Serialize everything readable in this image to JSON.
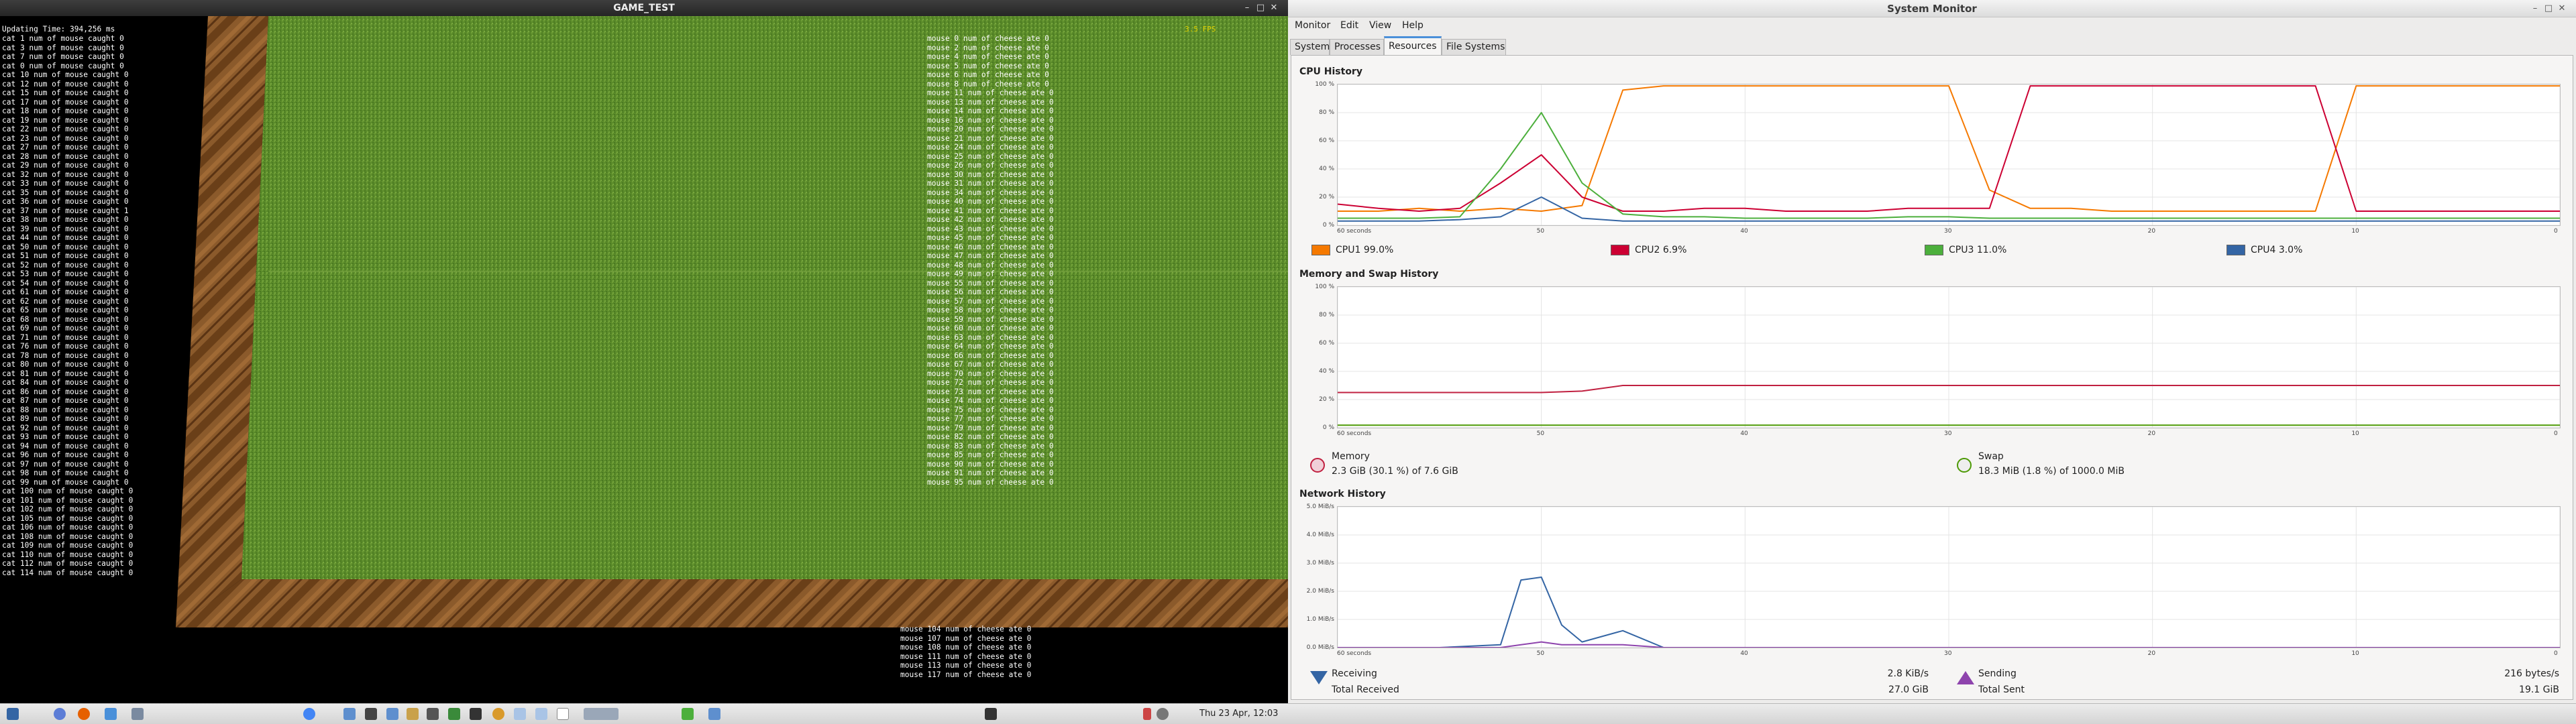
{
  "game": {
    "title": "GAME_TEST",
    "update_line": "Updating Time: 394,256 ms",
    "fps": "3.5 FPS",
    "cat_lines": [
      "cat 1 num of mouse caught 0",
      "cat 3 num of mouse caught 0",
      "cat 7 num of mouse caught 0",
      "cat 0 num of mouse caught 0",
      "cat 10 num of mouse caught 0",
      "cat 12 num of mouse caught 0",
      "cat 15 num of mouse caught 0",
      "cat 17 num of mouse caught 0",
      "cat 18 num of mouse caught 0",
      "cat 19 num of mouse caught 0",
      "cat 22 num of mouse caught 0",
      "cat 23 num of mouse caught 0",
      "cat 27 num of mouse caught 0",
      "cat 28 num of mouse caught 0",
      "cat 29 num of mouse caught 0",
      "cat 32 num of mouse caught 0",
      "cat 33 num of mouse caught 0",
      "cat 35 num of mouse caught 0",
      "cat 36 num of mouse caught 0",
      "cat 37 num of mouse caught 1",
      "cat 38 num of mouse caught 0",
      "cat 39 num of mouse caught 0",
      "cat 44 num of mouse caught 0",
      "cat 50 num of mouse caught 0",
      "cat 51 num of mouse caught 0",
      "cat 52 num of mouse caught 0",
      "cat 53 num of mouse caught 0",
      "cat 54 num of mouse caught 0",
      "cat 61 num of mouse caught 0",
      "cat 62 num of mouse caught 0",
      "cat 65 num of mouse caught 0",
      "cat 68 num of mouse caught 0",
      "cat 69 num of mouse caught 0",
      "cat 71 num of mouse caught 0",
      "cat 76 num of mouse caught 0",
      "cat 78 num of mouse caught 0",
      "cat 80 num of mouse caught 0",
      "cat 81 num of mouse caught 0",
      "cat 84 num of mouse caught 0",
      "cat 86 num of mouse caught 0",
      "cat 87 num of mouse caught 0",
      "cat 88 num of mouse caught 0",
      "cat 89 num of mouse caught 0",
      "cat 92 num of mouse caught 0",
      "cat 93 num of mouse caught 0",
      "cat 94 num of mouse caught 0",
      "cat 96 num of mouse caught 0",
      "cat 97 num of mouse caught 0",
      "cat 98 num of mouse caught 0",
      "cat 99 num of mouse caught 0",
      "cat 100 num of mouse caught 0",
      "cat 101 num of mouse caught 0",
      "cat 102 num of mouse caught 0",
      "cat 105 num of mouse caught 0",
      "cat 106 num of mouse caught 0",
      "cat 108 num of mouse caught 0",
      "cat 109 num of mouse caught 0",
      "cat 110 num of mouse caught 0",
      "cat 112 num of mouse caught 0",
      "cat 114 num of mouse caught 0"
    ],
    "mouse_lines": [
      "mouse 0 num of cheese ate 0",
      "mouse 2 num of cheese ate 0",
      "mouse 4 num of cheese ate 0",
      "mouse 5 num of cheese ate 0",
      "mouse 6 num of cheese ate 0",
      "mouse 8 num of cheese ate 0",
      "mouse 11 num of cheese ate 0",
      "mouse 13 num of cheese ate 0",
      "mouse 14 num of cheese ate 0",
      "mouse 16 num of cheese ate 0",
      "mouse 20 num of cheese ate 0",
      "mouse 21 num of cheese ate 0",
      "mouse 24 num of cheese ate 0",
      "mouse 25 num of cheese ate 0",
      "mouse 26 num of cheese ate 0",
      "mouse 30 num of cheese ate 0",
      "mouse 31 num of cheese ate 0",
      "mouse 34 num of cheese ate 0",
      "mouse 40 num of cheese ate 0",
      "mouse 41 num of cheese ate 0",
      "mouse 42 num of cheese ate 0",
      "mouse 43 num of cheese ate 0",
      "mouse 45 num of cheese ate 0",
      "mouse 46 num of cheese ate 0",
      "mouse 47 num of cheese ate 0",
      "mouse 48 num of cheese ate 0",
      "mouse 49 num of cheese ate 0",
      "mouse 55 num of cheese ate 0",
      "mouse 56 num of cheese ate 0",
      "mouse 57 num of cheese ate 0",
      "mouse 58 num of cheese ate 0",
      "mouse 59 num of cheese ate 0",
      "mouse 60 num of cheese ate 0",
      "mouse 63 num of cheese ate 0",
      "mouse 64 num of cheese ate 0",
      "mouse 66 num of cheese ate 0",
      "mouse 67 num of cheese ate 0",
      "mouse 70 num of cheese ate 0",
      "mouse 72 num of cheese ate 0",
      "mouse 73 num of cheese ate 0",
      "mouse 74 num of cheese ate 0",
      "mouse 75 num of cheese ate 0",
      "mouse 77 num of cheese ate 0",
      "mouse 79 num of cheese ate 0",
      "mouse 82 num of cheese ate 0",
      "mouse 83 num of cheese ate 0",
      "mouse 85 num of cheese ate 0",
      "mouse 90 num of cheese ate 0",
      "mouse 91 num of cheese ate 0",
      "mouse 95 num of cheese ate 0"
    ],
    "mouse_lines_bottom": [
      "mouse 104 num of cheese ate 0",
      "mouse 107 num of cheese ate 0",
      "mouse 108 num of cheese ate 0",
      "mouse 111 num of cheese ate 0",
      "mouse 113 num of cheese ate 0",
      "mouse 117 num of cheese ate 0"
    ]
  },
  "taskbar": {
    "clock": "Thu 23 Apr, 12:03"
  },
  "sysmon": {
    "title": "System Monitor",
    "menus": [
      "Monitor",
      "Edit",
      "View",
      "Help"
    ],
    "tabs": [
      "System",
      "Processes",
      "Resources",
      "File Systems"
    ],
    "active_tab": "Resources",
    "cpu_title": "CPU History",
    "mem_title": "Memory and Swap History",
    "net_title": "Network History",
    "x_ticks": [
      "60 seconds",
      "50",
      "40",
      "30",
      "20",
      "10",
      "0"
    ],
    "cpu_y_ticks": [
      "100 %",
      "80 %",
      "60 %",
      "40 %",
      "20 %",
      "0 %"
    ],
    "mem_y_ticks": [
      "100 %",
      "80 %",
      "60 %",
      "40 %",
      "20 %",
      "0 %"
    ],
    "net_y_ticks": [
      "5.0 MiB/s",
      "4.0 MiB/s",
      "3.0 MiB/s",
      "2.0 MiB/s",
      "1.0 MiB/s",
      "0.0 MiB/s"
    ],
    "cpu_legend": [
      {
        "label": "CPU1",
        "value": "99.0%",
        "color": "#f57900"
      },
      {
        "label": "CPU2",
        "value": "6.9%",
        "color": "#cc0033"
      },
      {
        "label": "CPU3",
        "value": "11.0%",
        "color": "#4caf3c"
      },
      {
        "label": "CPU4",
        "value": "3.0%",
        "color": "#3465a4"
      }
    ],
    "memory": {
      "label": "Memory",
      "value": "2.3 GiB (30.1 %) of 7.6 GiB",
      "color": "#c02040"
    },
    "swap": {
      "label": "Swap",
      "value": "18.3 MiB (1.8 %) of 1000.0 MiB",
      "color": "#4e9a06"
    },
    "network": {
      "receiving_label": "Receiving",
      "receiving_value": "2.8 KiB/s",
      "total_received_label": "Total Received",
      "total_received_value": "27.0 GiB",
      "sending_label": "Sending",
      "sending_value": "216 bytes/s",
      "total_sent_label": "Total Sent",
      "total_sent_value": "19.1 GiB"
    }
  },
  "chart_data": [
    {
      "type": "line",
      "title": "CPU History",
      "x": [
        60,
        58,
        56,
        54,
        52,
        50,
        48,
        46,
        44,
        42,
        40,
        38,
        36,
        34,
        32,
        30,
        28,
        26,
        24,
        22,
        20,
        18,
        16,
        14,
        12,
        10,
        8,
        6,
        4,
        2,
        0
      ],
      "ylim": [
        0,
        100
      ],
      "series": [
        {
          "name": "CPU1",
          "values": [
            10,
            10,
            12,
            10,
            12,
            10,
            14,
            96,
            99,
            99,
            99,
            99,
            99,
            99,
            99,
            99,
            25,
            12,
            12,
            10,
            10,
            10,
            10,
            10,
            10,
            99,
            99,
            99,
            99,
            99,
            99
          ]
        },
        {
          "name": "CPU2",
          "values": [
            15,
            12,
            10,
            12,
            30,
            50,
            20,
            10,
            10,
            12,
            12,
            10,
            10,
            10,
            12,
            12,
            12,
            99,
            99,
            99,
            99,
            99,
            99,
            99,
            99,
            10,
            10,
            10,
            10,
            10,
            10
          ]
        },
        {
          "name": "CPU3",
          "values": [
            5,
            5,
            5,
            6,
            40,
            80,
            30,
            8,
            6,
            6,
            5,
            5,
            5,
            5,
            6,
            6,
            5,
            5,
            5,
            5,
            5,
            5,
            5,
            5,
            5,
            5,
            5,
            5,
            5,
            5,
            5
          ]
        },
        {
          "name": "CPU4",
          "values": [
            3,
            3,
            3,
            4,
            6,
            20,
            5,
            3,
            3,
            3,
            3,
            3,
            3,
            3,
            3,
            3,
            3,
            3,
            3,
            3,
            3,
            3,
            3,
            3,
            3,
            3,
            3,
            3,
            3,
            3,
            3
          ]
        }
      ]
    },
    {
      "type": "line",
      "title": "Memory and Swap History",
      "x": [
        60,
        50,
        48,
        46,
        40,
        30,
        20,
        10,
        0
      ],
      "ylim": [
        0,
        100
      ],
      "series": [
        {
          "name": "Memory",
          "values": [
            25,
            25,
            26,
            30,
            30,
            30,
            30,
            30,
            30
          ]
        },
        {
          "name": "Swap",
          "values": [
            1.8,
            1.8,
            1.8,
            1.8,
            1.8,
            1.8,
            1.8,
            1.8,
            1.8
          ]
        }
      ]
    },
    {
      "type": "line",
      "title": "Network History",
      "x": [
        60,
        55,
        52,
        51,
        50,
        49,
        48,
        46,
        44,
        40,
        30,
        20,
        10,
        0
      ],
      "ylim": [
        0,
        5
      ],
      "series": [
        {
          "name": "Receiving",
          "values": [
            0,
            0,
            0.1,
            2.4,
            2.5,
            0.8,
            0.2,
            0.6,
            0,
            0,
            0,
            0,
            0,
            0
          ]
        },
        {
          "name": "Sending",
          "values": [
            0,
            0,
            0,
            0.1,
            0.2,
            0.1,
            0.1,
            0.1,
            0,
            0,
            0,
            0,
            0,
            0
          ]
        }
      ]
    }
  ]
}
